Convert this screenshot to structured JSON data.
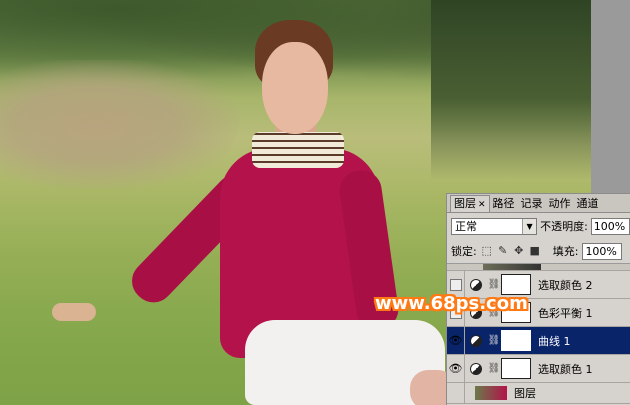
{
  "panel": {
    "tabs": [
      {
        "label": "图层",
        "active": true,
        "closable": true
      },
      {
        "label": "路径"
      },
      {
        "label": "记录"
      },
      {
        "label": "动作"
      },
      {
        "label": "通道"
      }
    ],
    "blend_mode": "正常",
    "opacity_label": "不透明度:",
    "opacity_value": "100%",
    "lock_label": "锁定:",
    "fill_label": "填充:",
    "fill_value": "100%",
    "layers": [
      {
        "name": "选取颜色 2",
        "visible": false,
        "selected": false
      },
      {
        "name": "色彩平衡 1",
        "visible": false,
        "selected": false
      },
      {
        "name": "曲线 1",
        "visible": true,
        "selected": true
      },
      {
        "name": "选取颜色 1",
        "visible": true,
        "selected": false
      }
    ],
    "bottom_layer_partial": "图层"
  },
  "watermark": "www.68ps.com",
  "colors": {
    "panel_bg": "#d6d3ce",
    "selected_row": "#0a246a",
    "watermark_outline": "#ff7a14",
    "shirt": "#b3124a"
  }
}
